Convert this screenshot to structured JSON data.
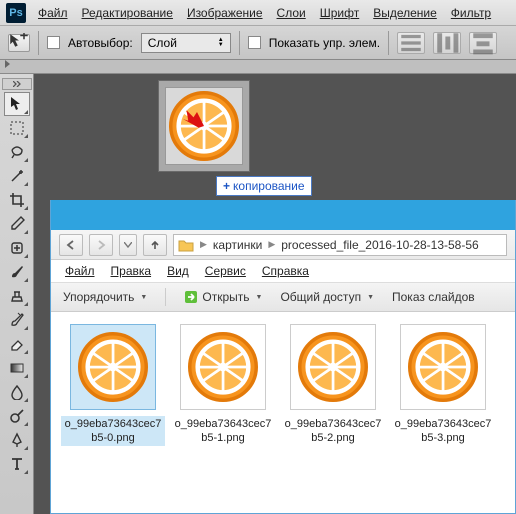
{
  "ps": {
    "logo": "Ps",
    "menu": [
      "Файл",
      "Редактирование",
      "Изображение",
      "Слои",
      "Шрифт",
      "Выделение",
      "Фильтр"
    ],
    "options": {
      "autoselect_label": "Автовыбор:",
      "select_value": "Слой",
      "show_controls_label": "Показать упр. элем."
    }
  },
  "copy_hint": "копирование",
  "explorer": {
    "address": {
      "part1": "картинки",
      "part2": "processed_file_2016-10-28-13-58-56"
    },
    "menu": [
      "Файл",
      "Правка",
      "Вид",
      "Сервис",
      "Справка"
    ],
    "toolbar": {
      "organize": "Упорядочить",
      "open": "Открыть",
      "share": "Общий доступ",
      "slideshow": "Показ слайдов"
    },
    "files": [
      {
        "name": "o_99eba73643cec7b5-0.png",
        "selected": true
      },
      {
        "name": "o_99eba73643cec7b5-1.png",
        "selected": false
      },
      {
        "name": "o_99eba73643cec7b5-2.png",
        "selected": false
      },
      {
        "name": "o_99eba73643cec7b5-3.png",
        "selected": false
      }
    ]
  },
  "colors": {
    "orange_fill": "#f7941e",
    "orange_stroke": "#e37a0a",
    "red_dot": "#dd1010",
    "explorer_title": "#2fa3df"
  }
}
